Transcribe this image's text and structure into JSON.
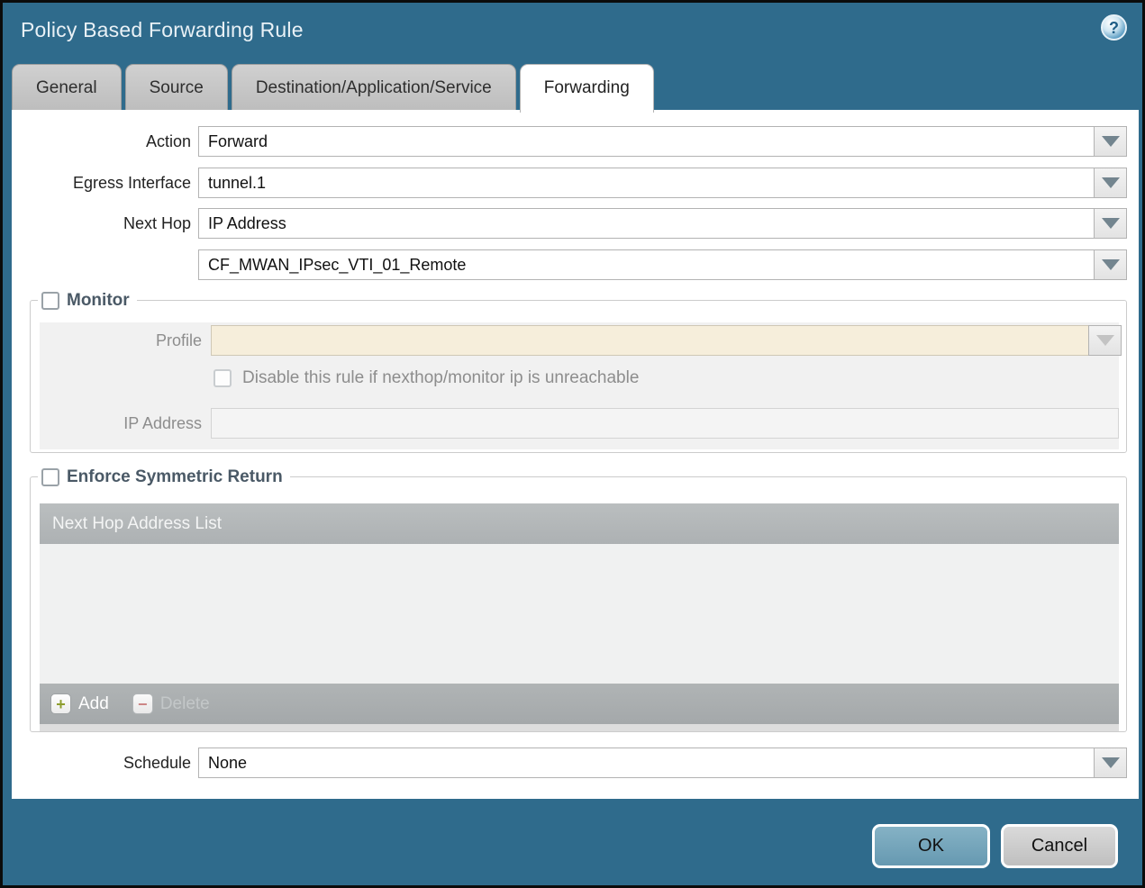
{
  "window": {
    "title": "Policy Based Forwarding Rule",
    "help_glyph": "?"
  },
  "tabs": [
    {
      "label": "General",
      "active": false
    },
    {
      "label": "Source",
      "active": false
    },
    {
      "label": "Destination/Application/Service",
      "active": false
    },
    {
      "label": "Forwarding",
      "active": true
    }
  ],
  "form": {
    "action": {
      "label": "Action",
      "value": "Forward"
    },
    "egress_interface": {
      "label": "Egress Interface",
      "value": "tunnel.1"
    },
    "next_hop": {
      "label": "Next Hop",
      "value": "IP Address"
    },
    "next_hop_address": {
      "value": "CF_MWAN_IPsec_VTI_01_Remote"
    },
    "schedule": {
      "label": "Schedule",
      "value": "None"
    }
  },
  "monitor": {
    "legend": "Monitor",
    "checked": false,
    "profile": {
      "label": "Profile",
      "value": ""
    },
    "disable_rule": {
      "label": "Disable this rule if nexthop/monitor ip is unreachable",
      "checked": false
    },
    "ip_address": {
      "label": "IP Address",
      "value": ""
    }
  },
  "symmetric_return": {
    "legend": "Enforce Symmetric Return",
    "checked": false,
    "table": {
      "type": "table",
      "header": "Next Hop Address List",
      "rows": []
    },
    "add_label": "Add",
    "delete_label": "Delete"
  },
  "footer": {
    "ok_label": "OK",
    "cancel_label": "Cancel"
  },
  "colors": {
    "frame_teal": "#2f6b8c",
    "tab_inactive": "#c4c4c4",
    "active_tab_bg": "#ffffff",
    "profile_field_bg": "#f6eedb",
    "panel_gray": "#f1f1f1",
    "table_header": "#b2b6b7",
    "table_footer": "#a9adae",
    "ok_button": "#6fa3ba",
    "add_plus_green": "#8e9e2f",
    "delete_minus_red": "#cc8585"
  }
}
